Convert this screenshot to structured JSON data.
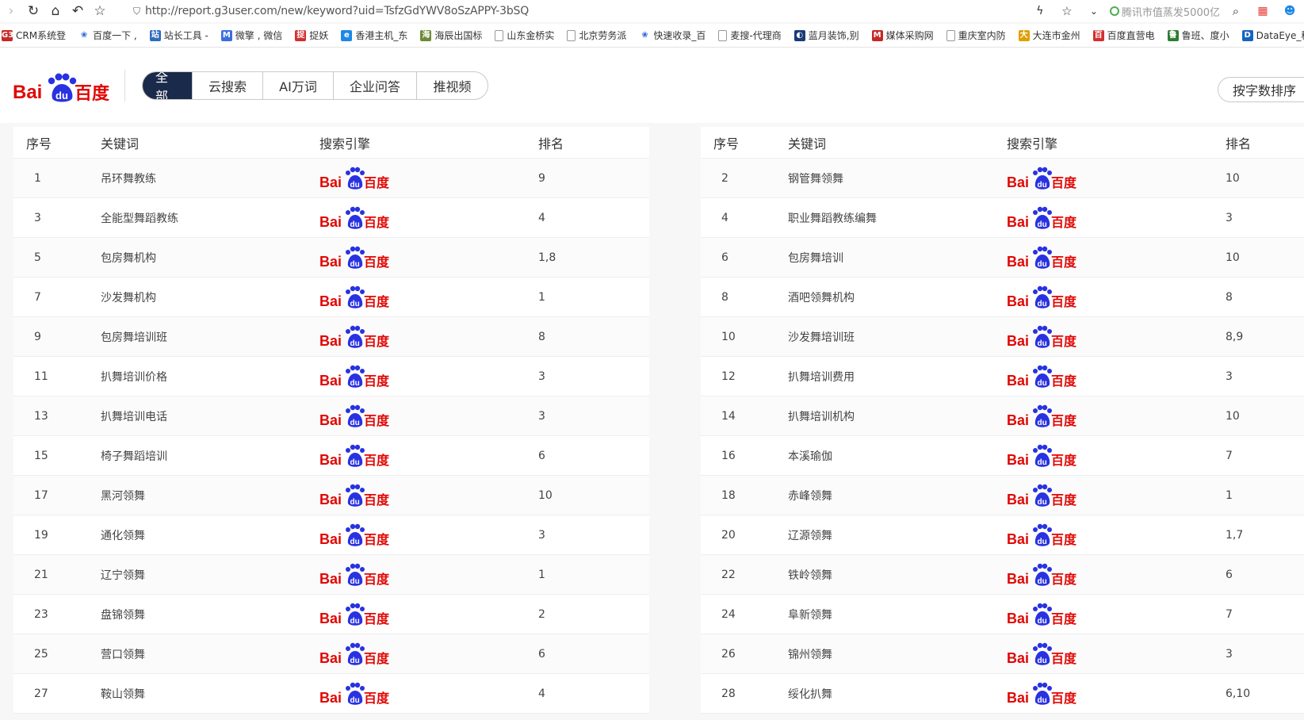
{
  "browser": {
    "url": "http://report.g3user.com/new/keyword?uid=TsfzGdYWV8oSzAPPY-3bSQ",
    "news": "腾讯市值蒸发5000亿"
  },
  "bookmarks": [
    {
      "label": "CRM系统登",
      "color": "#c62828",
      "icon": "G3"
    },
    {
      "label": "百度一下 ,",
      "color": "#2a62d8",
      "icon": "paw"
    },
    {
      "label": "站长工具 -",
      "color": "#2f6cbf",
      "icon": "站"
    },
    {
      "label": "微擎 , 微信",
      "color": "#3b6fe0",
      "icon": "M"
    },
    {
      "label": "捉妖",
      "color": "#d32f2f",
      "icon": "捉"
    },
    {
      "label": "香港主机_东",
      "color": "#1e88e5",
      "icon": "e"
    },
    {
      "label": "海辰出国标",
      "color": "#6d8a36",
      "icon": "海"
    },
    {
      "label": "山东金桥实",
      "color": "#999",
      "icon": "doc"
    },
    {
      "label": "北京劳务派",
      "color": "#999",
      "icon": "doc"
    },
    {
      "label": "快速收录_百",
      "color": "#2a62d8",
      "icon": "paw"
    },
    {
      "label": "麦搜-代理商",
      "color": "#999",
      "icon": "doc"
    },
    {
      "label": "蓝月装饰,别",
      "color": "#1a3a7a",
      "icon": "◐"
    },
    {
      "label": "媒体采购网",
      "color": "#c62828",
      "icon": "M"
    },
    {
      "label": "重庆室内防",
      "color": "#999",
      "icon": "doc"
    },
    {
      "label": "大连市金州",
      "color": "#e0a000",
      "icon": "大"
    },
    {
      "label": "百度直营电",
      "color": "#d32f2f",
      "icon": "百"
    },
    {
      "label": "鲁班、度小",
      "color": "#2e7d32",
      "icon": "鲁"
    },
    {
      "label": "DataEye_移",
      "color": "#1565c0",
      "icon": "D"
    }
  ],
  "logo": {
    "text_bai": "Bai",
    "text_du": "du",
    "text_cn": "百度"
  },
  "tabs": [
    {
      "label": "全部",
      "active": true
    },
    {
      "label": "云搜索",
      "active": false
    },
    {
      "label": "AI万词",
      "active": false
    },
    {
      "label": "企业问答",
      "active": false
    },
    {
      "label": "推视频",
      "active": false
    }
  ],
  "sort_button": "按字数排序",
  "columns": {
    "no": "序号",
    "keyword": "关键词",
    "engine": "搜索引擎",
    "rank": "排名"
  },
  "left_rows": [
    {
      "no": "1",
      "keyword": "吊环舞教练",
      "rank": "9"
    },
    {
      "no": "3",
      "keyword": "全能型舞蹈教练",
      "rank": "4"
    },
    {
      "no": "5",
      "keyword": "包房舞机构",
      "rank": "1,8"
    },
    {
      "no": "7",
      "keyword": "沙发舞机构",
      "rank": "1"
    },
    {
      "no": "9",
      "keyword": "包房舞培训班",
      "rank": "8"
    },
    {
      "no": "11",
      "keyword": "扒舞培训价格",
      "rank": "3"
    },
    {
      "no": "13",
      "keyword": "扒舞培训电话",
      "rank": "3"
    },
    {
      "no": "15",
      "keyword": "椅子舞蹈培训",
      "rank": "6"
    },
    {
      "no": "17",
      "keyword": "黑河领舞",
      "rank": "10"
    },
    {
      "no": "19",
      "keyword": "通化领舞",
      "rank": "3"
    },
    {
      "no": "21",
      "keyword": "辽宁领舞",
      "rank": "1"
    },
    {
      "no": "23",
      "keyword": "盘锦领舞",
      "rank": "2"
    },
    {
      "no": "25",
      "keyword": "营口领舞",
      "rank": "6"
    },
    {
      "no": "27",
      "keyword": "鞍山领舞",
      "rank": "4"
    }
  ],
  "right_rows": [
    {
      "no": "2",
      "keyword": "钢管舞领舞",
      "rank": "10"
    },
    {
      "no": "4",
      "keyword": "职业舞蹈教练编舞",
      "rank": "3"
    },
    {
      "no": "6",
      "keyword": "包房舞培训",
      "rank": "10"
    },
    {
      "no": "8",
      "keyword": "酒吧领舞机构",
      "rank": "8"
    },
    {
      "no": "10",
      "keyword": "沙发舞培训班",
      "rank": "8,9"
    },
    {
      "no": "12",
      "keyword": "扒舞培训费用",
      "rank": "3"
    },
    {
      "no": "14",
      "keyword": "扒舞培训机构",
      "rank": "10"
    },
    {
      "no": "16",
      "keyword": "本溪瑜伽",
      "rank": "7"
    },
    {
      "no": "18",
      "keyword": "赤峰领舞",
      "rank": "1"
    },
    {
      "no": "20",
      "keyword": "辽源领舞",
      "rank": "1,7"
    },
    {
      "no": "22",
      "keyword": "铁岭领舞",
      "rank": "6"
    },
    {
      "no": "24",
      "keyword": "阜新领舞",
      "rank": "7"
    },
    {
      "no": "26",
      "keyword": "锦州领舞",
      "rank": "3"
    },
    {
      "no": "28",
      "keyword": "绥化扒舞",
      "rank": "6,10"
    }
  ],
  "colors": {
    "baidu_red": "#e10602",
    "baidu_blue": "#2932e1",
    "tab_active": "#1a2a4a"
  }
}
